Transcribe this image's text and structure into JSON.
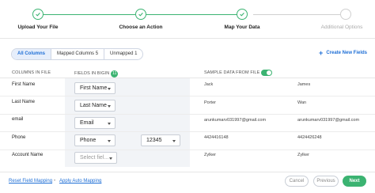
{
  "stepper": {
    "steps": [
      {
        "label": "Upload Your File",
        "state": "done"
      },
      {
        "label": "Choose an Action",
        "state": "done"
      },
      {
        "label": "Map Your Data",
        "state": "current"
      },
      {
        "label": "Additional Options",
        "state": "pending"
      }
    ]
  },
  "tabs": [
    {
      "label": "All Columns",
      "active": true
    },
    {
      "label": "Mapped Columns 5",
      "active": false
    },
    {
      "label": "Unmapped 1",
      "active": false
    }
  ],
  "create_field": {
    "label": "Create New Fields",
    "icon": "plus-icon"
  },
  "table": {
    "headers": {
      "columns_in_file": "COLUMNS IN FILE",
      "fields_in_bigin": "FIELDS IN BIGIN",
      "fields_count": "11",
      "sample_data": "SAMPLE DATA FROM FILE",
      "sample_toggle_on": true
    },
    "rows": [
      {
        "column": "First Name",
        "field": "First Name",
        "sample1": "Jack",
        "sample2": "James"
      },
      {
        "column": "Last Name",
        "field": "Last Name",
        "sample1": "Porter",
        "sample2": "Wan"
      },
      {
        "column": "email",
        "field": "Email",
        "sample1": "arunkumarv031997@gmail.com",
        "sample2": "arunkumarv031997@gmail.com"
      },
      {
        "column": "Phone",
        "field": "Phone",
        "extra": "12345",
        "sample1": "4424416148",
        "sample2": "4424426248"
      },
      {
        "column": "Account Name",
        "field": "Select fiel...",
        "sample1": "Zylker",
        "sample2": "Zylker"
      }
    ]
  },
  "footer": {
    "reset_link": "Reset Field Mapping",
    "separator": "•",
    "auto_link": "Apply Auto Mapping",
    "cancel": "Cancel",
    "previous": "Previous",
    "next": "Next"
  },
  "colors": {
    "accent": "#3bb371",
    "link": "#1f6fd6"
  }
}
